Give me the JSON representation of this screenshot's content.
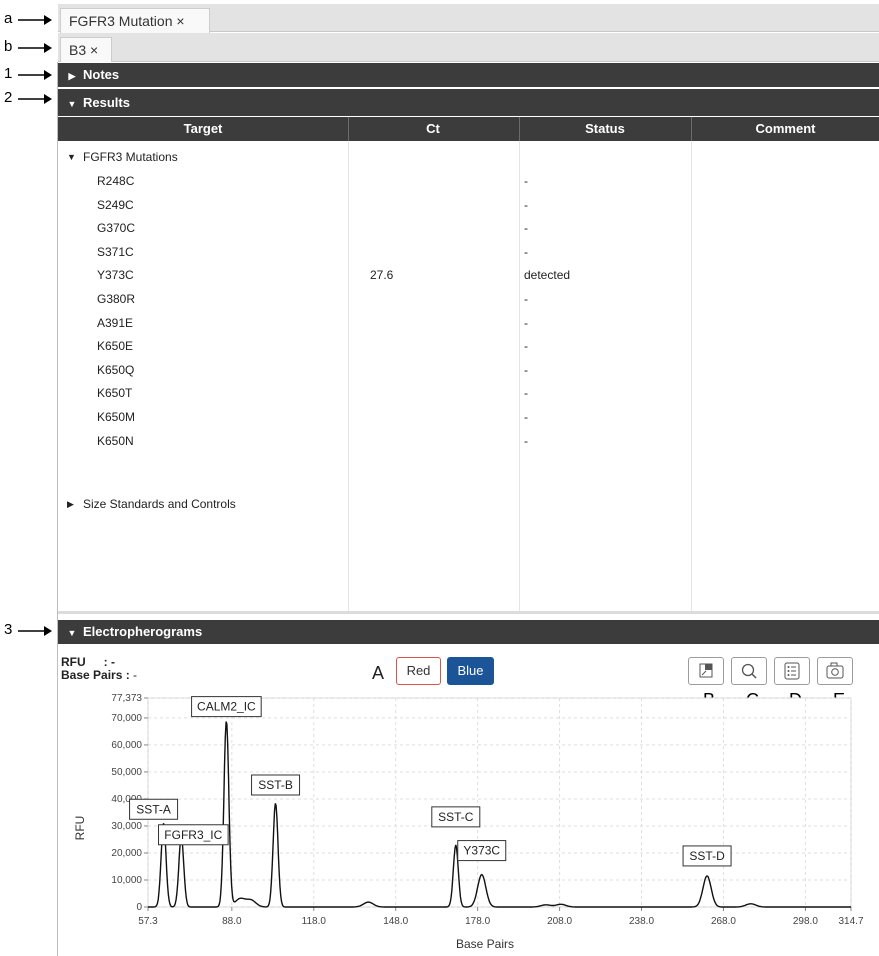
{
  "annotations": {
    "tab_row": "a",
    "subtab_row": "b",
    "notes": "1",
    "results": "2",
    "electropherograms": "3",
    "channel_buttons": "A",
    "tool_1": "B",
    "tool_2": "C",
    "tool_3": "D",
    "tool_4": "E"
  },
  "tabs": {
    "main": "FGFR3 Mutation ×",
    "sub": "B3 ×"
  },
  "sections": {
    "notes": "Notes",
    "results": "Results",
    "electropherograms": "Electropherograms"
  },
  "table": {
    "headers": [
      "Target",
      "Ct",
      "Status",
      "Comment"
    ],
    "group": "FGFR3 Mutations",
    "rows": [
      {
        "target": "R248C",
        "ct": "",
        "status": "-"
      },
      {
        "target": "S249C",
        "ct": "",
        "status": "-"
      },
      {
        "target": "G370C",
        "ct": "",
        "status": "-"
      },
      {
        "target": "S371C",
        "ct": "",
        "status": "-"
      },
      {
        "target": "Y373C",
        "ct": "27.6",
        "status": "detected"
      },
      {
        "target": "G380R",
        "ct": "",
        "status": "-"
      },
      {
        "target": "A391E",
        "ct": "",
        "status": "-"
      },
      {
        "target": "K650E",
        "ct": "",
        "status": "-"
      },
      {
        "target": "K650Q",
        "ct": "",
        "status": "-"
      },
      {
        "target": "K650T",
        "ct": "",
        "status": "-"
      },
      {
        "target": "K650M",
        "ct": "",
        "status": "-"
      },
      {
        "target": "K650N",
        "ct": "",
        "status": "-"
      }
    ],
    "collapsed_group": "Size Standards and Controls"
  },
  "readout": {
    "rfu_label": "RFU",
    "rfu_value": ": -",
    "bp_label": "Base Pairs :",
    "bp_value": " -"
  },
  "channels": {
    "red": "Red",
    "blue": "Blue"
  },
  "colors": {
    "header_dark": "#3c3c3c",
    "blue_active": "#1c5597",
    "red_border": "#d9534f"
  },
  "icons": [
    "legend-icon",
    "zoom-icon",
    "list-icon",
    "camera-icon"
  ],
  "chart_data": {
    "type": "line",
    "xlabel": "Base Pairs",
    "ylabel": "RFU",
    "xlim": [
      57.3,
      314.7
    ],
    "ylim": [
      0,
      77373
    ],
    "x_ticks": [
      57.3,
      88.0,
      118.0,
      148.0,
      178.0,
      208.0,
      238.0,
      268.0,
      298.0,
      314.7
    ],
    "x_tick_labels": [
      "57.3",
      "88.0",
      "118.0",
      "148.0",
      "178.0",
      "208.0",
      "238.0",
      "268.0",
      "298.0",
      "314.7"
    ],
    "y_ticks": [
      0,
      10000,
      20000,
      30000,
      40000,
      50000,
      60000,
      70000,
      77373
    ],
    "y_tick_labels": [
      "0",
      "10,000",
      "20,000",
      "30,000",
      "40,000",
      "50,000",
      "60,000",
      "70,000",
      "77,373"
    ],
    "grid": true,
    "peaks": [
      {
        "x": 63.0,
        "y": 31000,
        "label": "SST-A"
      },
      {
        "x": 69.5,
        "y": 26000,
        "label": "FGFR3_IC"
      },
      {
        "x": 86.0,
        "y": 69000,
        "label": "CALM2_IC"
      },
      {
        "x": 91.0,
        "y": 3000
      },
      {
        "x": 95.0,
        "y": 2500
      },
      {
        "x": 104.0,
        "y": 38500,
        "label": "SST-B"
      },
      {
        "x": 138.0,
        "y": 1800
      },
      {
        "x": 170.0,
        "y": 23000,
        "label": "SST-C"
      },
      {
        "x": 179.5,
        "y": 12000,
        "label": "Y373C"
      },
      {
        "x": 203.0,
        "y": 800
      },
      {
        "x": 208.5,
        "y": 1000
      },
      {
        "x": 262.0,
        "y": 11500,
        "label": "SST-D"
      },
      {
        "x": 278.0,
        "y": 1200
      }
    ]
  }
}
